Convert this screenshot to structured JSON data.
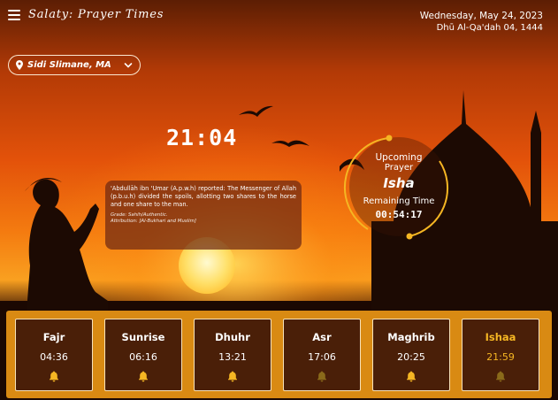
{
  "header": {
    "title": "Salaty: Prayer Times",
    "gregorian_date": "Wednesday, May 24, 2023",
    "hijri_date": "Dhū Al-Qa'dah 04, 1444"
  },
  "location": {
    "label": "Sidi Slimane, MA"
  },
  "clock": {
    "time": "21:04"
  },
  "hadith": {
    "text": "'Abdullāh ibn 'Umar (A.p.w.h) reported: The Messenger of Allah (p.b.u.h) divided the spoils, allotting two shares to the horse and one share to the man.",
    "grade": "Grade: Sahih/Authentic.",
    "attribution": "Attribution: [Al-Bukhari and Muslim]"
  },
  "upcoming": {
    "line1": "Upcoming",
    "line2": "Prayer",
    "name": "Isha",
    "remaining_label": "Remaining Time",
    "remaining": "00:54:17"
  },
  "prayers": [
    {
      "name": "Fajr",
      "time": "04:36",
      "bell": "bell-icon",
      "bell_color": "#f5b623"
    },
    {
      "name": "Sunrise",
      "time": "06:16",
      "bell": "bell-icon",
      "bell_color": "#f5b623"
    },
    {
      "name": "Dhuhr",
      "time": "13:21",
      "bell": "bell-icon",
      "bell_color": "#f5b623"
    },
    {
      "name": "Asr",
      "time": "17:06",
      "bell": "bell-icon",
      "bell_color": "#8a6a1a"
    },
    {
      "name": "Maghrib",
      "time": "20:25",
      "bell": "bell-icon",
      "bell_color": "#f5b623"
    },
    {
      "name": "Ishaa",
      "time": "21:59",
      "bell": "bell-icon",
      "bell_color": "#8a6a1a"
    }
  ],
  "colors": {
    "accent": "#f5b623",
    "bar": "#d98a13",
    "card": "#4a1f08"
  }
}
